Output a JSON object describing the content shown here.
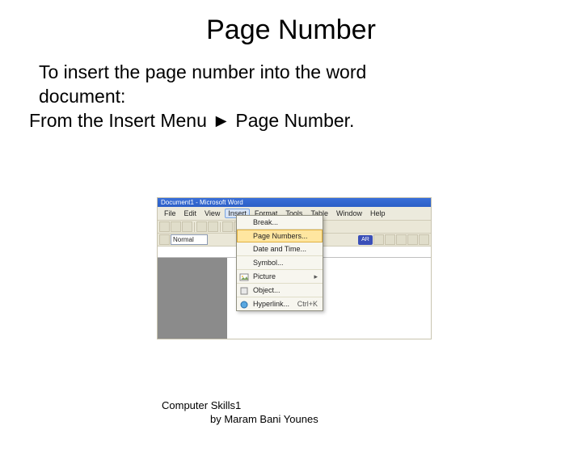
{
  "title": "Page Number",
  "body": {
    "line1": "To insert the page number into the word",
    "line2": "document:",
    "line3": "From the Insert Menu ► Page Number."
  },
  "screenshot": {
    "titlebar": "Document1 - Microsoft Word",
    "menubar": {
      "items": [
        "File",
        "Edit",
        "View",
        "Insert",
        "Format",
        "Tools",
        "Table",
        "Window",
        "Help"
      ],
      "active_index": 3
    },
    "toolbar2": {
      "style": "Normal"
    },
    "lang_badge": "AR",
    "insert_menu": {
      "items": [
        {
          "label": "Break...",
          "icon": ""
        },
        {
          "label": "Page Numbers...",
          "icon": "",
          "highlighted": true
        },
        {
          "label": "Date and Time...",
          "icon": ""
        },
        {
          "label": "Symbol...",
          "icon": ""
        },
        {
          "label": "Picture",
          "icon": "",
          "submenu": true
        },
        {
          "label": "Object...",
          "icon": ""
        },
        {
          "label": "Hyperlink...",
          "icon": "",
          "shortcut": "Ctrl+K"
        }
      ]
    }
  },
  "footer": {
    "line1": "Computer Skills1",
    "line2": "by Maram Bani Younes"
  }
}
